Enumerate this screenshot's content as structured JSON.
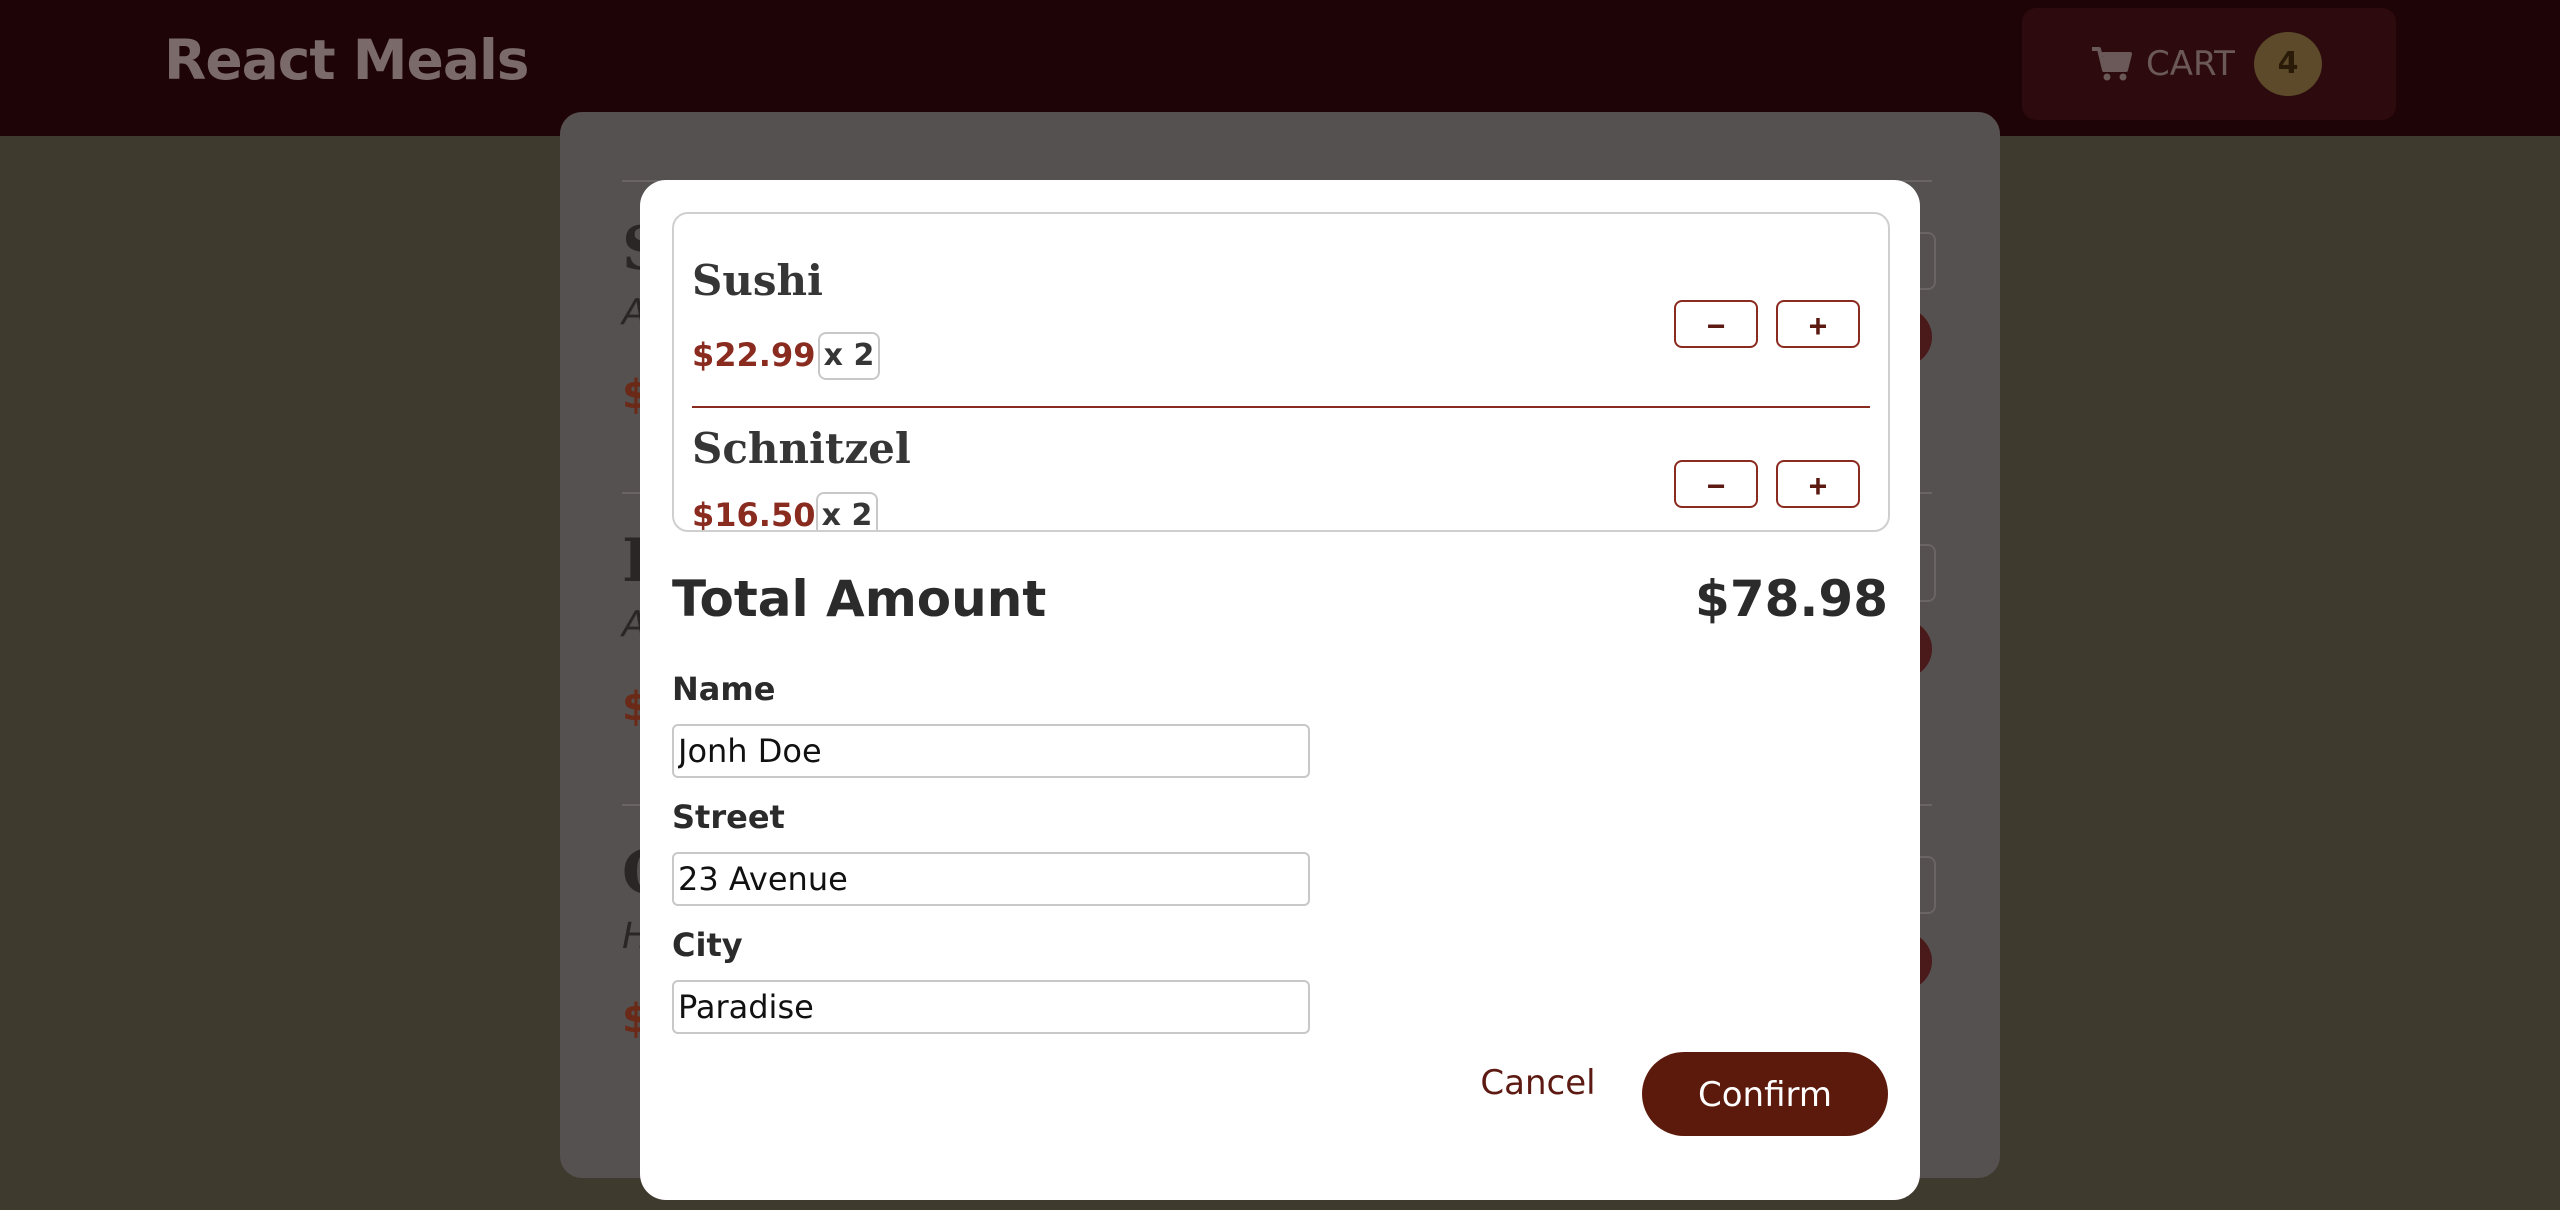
{
  "header": {
    "brand": "React Meals",
    "cart_label": "CART",
    "cart_count": "4",
    "cart_icon": "shopping-cart-icon"
  },
  "background_meals": [
    {
      "name": "S",
      "desc": "A",
      "price": "$"
    },
    {
      "name": "I",
      "desc": "A",
      "price": "$"
    },
    {
      "name": "C",
      "desc": "H",
      "price": "$"
    }
  ],
  "cart": {
    "items": [
      {
        "name": "Sushi",
        "price": "$22.99",
        "qty": "x 2",
        "minus": "−",
        "plus": "+"
      },
      {
        "name": "Schnitzel",
        "price": "$16.50",
        "qty": "x 2",
        "minus": "−",
        "plus": "+"
      }
    ],
    "total_label": "Total Amount",
    "total_value": "$78.98"
  },
  "form": {
    "name_label": "Name",
    "name_value": "Jonh Doe",
    "street_label": "Street",
    "street_value": "23 Avenue",
    "city_label": "City",
    "city_value": "Paradise",
    "cancel_label": "Cancel",
    "confirm_label": "Confirm"
  },
  "colors": {
    "header_bg": "#1f0407",
    "accent": "#8a2b1f",
    "confirm_bg": "#5c1a0c",
    "overlay_bg": "#3f3a2e"
  }
}
